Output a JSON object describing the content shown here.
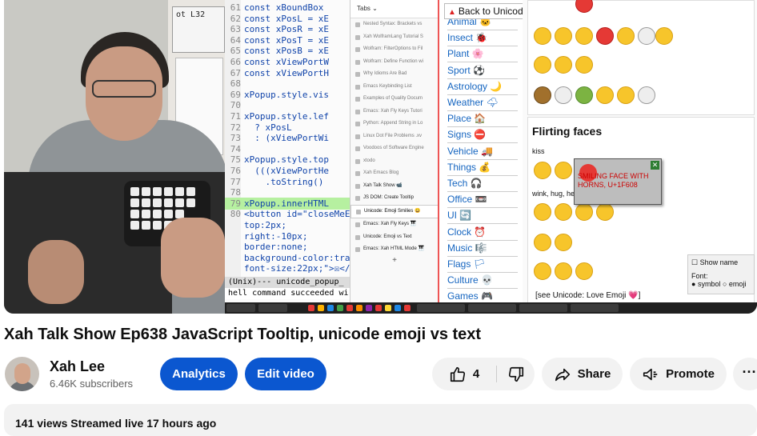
{
  "video": {
    "code": {
      "lines": [
        {
          "n": "61",
          "text": "const xBoundBox"
        },
        {
          "n": "62",
          "text": "const xPosL = xE"
        },
        {
          "n": "63",
          "text": "const xPosR = xE"
        },
        {
          "n": "64",
          "text": "const xPosT = xE"
        },
        {
          "n": "65",
          "text": "const xPosB = xE"
        },
        {
          "n": "66",
          "text": "const xViewPortW"
        },
        {
          "n": "67",
          "text": "const xViewPortH"
        },
        {
          "n": "68",
          "text": ""
        },
        {
          "n": "69",
          "text": "xPopup.style.vis"
        },
        {
          "n": "70",
          "text": ""
        },
        {
          "n": "71",
          "text": "xPopup.style.lef"
        },
        {
          "n": "72",
          "text": "  ? xPosL"
        },
        {
          "n": "73",
          "text": "  : (xViewPortWi"
        },
        {
          "n": "74",
          "text": ""
        },
        {
          "n": "75",
          "text": "xPopup.style.top"
        },
        {
          "n": "76",
          "text": "  (((xViewPortHe"
        },
        {
          "n": "77",
          "text": "    .toString()"
        },
        {
          "n": "78",
          "text": ""
        },
        {
          "n": "79",
          "text": "xPopup.innerHTML"
        },
        {
          "n": "80",
          "text": "<button id=\"closeMeEl7"
        },
        {
          "n": "",
          "text": "top:2px;"
        },
        {
          "n": "",
          "text": "right:-10px;"
        },
        {
          "n": "",
          "text": "border:none;"
        },
        {
          "n": "",
          "text": "background-color:trans"
        },
        {
          "n": "",
          "text": "font-size:22px;\">☒</"
        }
      ],
      "status": "(Unix)---  unicode_popup_",
      "minibuffer": "hell command succeeded wi"
    },
    "tabs": {
      "header": "Tabs ⌄",
      "items": [
        "Nested Syntax: Brackets vs",
        "Xah WolframLang Tutorial S",
        "Wolfram: FilterOptions to Fil",
        "Wolfram: Define Function wi",
        "Why Idioms Are Bad",
        "Emacs Keybinding List",
        "Examples of Quality Docum",
        "Emacs: Xah Fly Keys Tutori",
        "Python: Append String in Lo",
        "Linux Dot File Problems .xv",
        "Voodoos of Software Engine",
        "xtodo",
        "Xah Emacs Blog",
        "Xah Talk Show 📹",
        "JS DOM: Create Tooltip",
        "Unicode: Emoji Smilies 😀",
        "Emacs: Xah Fly Keys 🎹",
        "Unicode: Emoji vs Text",
        "Emacs: Xah HTML Mode 🎹"
      ],
      "plus": "+"
    },
    "nav": {
      "back": "Back to Unicode Search 🔎",
      "items": [
        "Animal 🐱",
        "Insect 🐞",
        "Plant 🌸",
        "Sport ⚽",
        "Astrology 🌙",
        "Weather 🌩",
        "Place 🏠",
        "Signs ⛔",
        "Vehicle 🚚",
        "Things 💰",
        "Tech 🎧",
        "Office 📼",
        "UI 🔄",
        "Clock ⏰",
        "Music 🎼",
        "Flags 🏳",
        "Culture 💀",
        "Games 🎮"
      ]
    },
    "emoji": {
      "heading": "Flirting faces",
      "label_kiss": "kiss",
      "label_wink": "wink, hug, he",
      "tooltip": "SMILING FACE WITH HORNS, U+1F608",
      "tooltip_close": "✕",
      "option_show_name": "Show name",
      "option_font": "Font:",
      "option_symbol": "symbol",
      "option_emoji": "emoji",
      "see": "[see Unicode: Love Emoji 💗]"
    }
  },
  "title": "Xah Talk Show Ep638 JavaScript Tooltip, unicode emoji vs text",
  "channel": {
    "name": "Xah Lee",
    "subscribers": "6.46K subscribers"
  },
  "actions": {
    "analytics": "Analytics",
    "edit": "Edit video",
    "likes": "4",
    "share": "Share",
    "promote": "Promote",
    "more": "···"
  },
  "description": {
    "stats": "141 views  Streamed live 17 hours ago"
  }
}
